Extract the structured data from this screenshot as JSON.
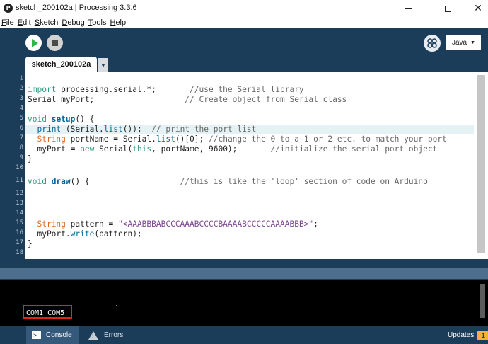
{
  "window": {
    "title": "sketch_200102a | Processing 3.3.6",
    "app_icon_glyph": "P",
    "minimize_icon": "minimize-icon",
    "maximize_icon": "maximize-icon",
    "close_glyph": "✕"
  },
  "menu": {
    "items": [
      {
        "first": "F",
        "rest": "ile"
      },
      {
        "first": "E",
        "rest": "dit"
      },
      {
        "first": "S",
        "rest": "ketch"
      },
      {
        "first": "D",
        "rest": "ebug"
      },
      {
        "first": "T",
        "rest": "ools"
      },
      {
        "first": "H",
        "rest": "elp"
      }
    ]
  },
  "toolbar": {
    "run_icon": "play-icon",
    "stop_icon": "stop-icon",
    "debug_icon": "debug-butterfly-icon",
    "debug_glyph": "ℌ",
    "mode_label": "Java",
    "mode_arrow": "▼"
  },
  "tabs": {
    "active_tab": "sketch_200102a",
    "menu_arrow": "▼"
  },
  "editor": {
    "line_numbers": [
      "1",
      "2",
      "3",
      "4",
      "5",
      "6",
      "7",
      "8",
      "9",
      "10",
      "11",
      "12",
      "13",
      "14",
      "15",
      "16",
      "17",
      "18"
    ]
  },
  "console": {
    "output": "COM1 COM5"
  },
  "bottom": {
    "console_tab": "Console",
    "console_icon_glyph": ">_",
    "errors_tab": "Errors",
    "errors_icon_glyph": "!",
    "updates_label": "Updates",
    "updates_count": "1"
  },
  "colors": {
    "toolbar_bg": "#1c3d5a",
    "run_green": "#2fb84a",
    "keyword": "#33997e",
    "type": "#e2661a",
    "function": "#006699",
    "comment": "#666666",
    "string": "#7d4793",
    "highlight_box": "#e2231a"
  }
}
